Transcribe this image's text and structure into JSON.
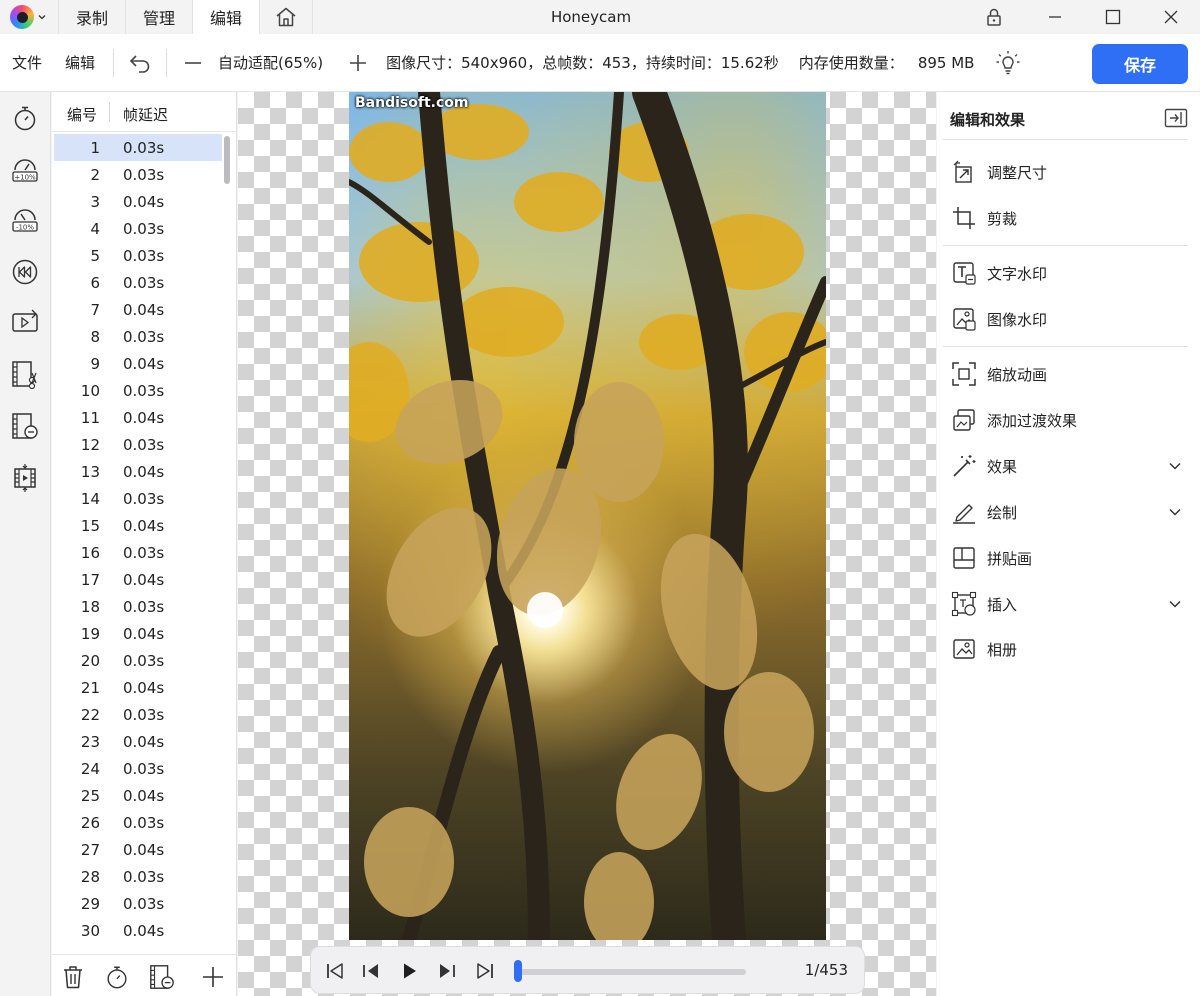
{
  "titlebar": {
    "tabs": [
      {
        "label": "录制"
      },
      {
        "label": "管理"
      },
      {
        "label": "编辑"
      }
    ],
    "active_tab": "编辑",
    "window_title": "Honeycam"
  },
  "toolbar": {
    "file_label": "文件",
    "edit_label": "编辑",
    "zoom_label": "自动适配(65%)",
    "info_text": "图像尺寸：540x960，总帧数：453，持续时间：15.62秒",
    "memory_label": "内存使用数量：",
    "memory_value": "895 MB",
    "save_label": "保存"
  },
  "frame_list": {
    "header_number": "编号",
    "header_delay": "帧延迟",
    "selected": 1,
    "rows": [
      {
        "n": "1",
        "d": "0.03s"
      },
      {
        "n": "2",
        "d": "0.03s"
      },
      {
        "n": "3",
        "d": "0.04s"
      },
      {
        "n": "4",
        "d": "0.03s"
      },
      {
        "n": "5",
        "d": "0.03s"
      },
      {
        "n": "6",
        "d": "0.03s"
      },
      {
        "n": "7",
        "d": "0.04s"
      },
      {
        "n": "8",
        "d": "0.03s"
      },
      {
        "n": "9",
        "d": "0.04s"
      },
      {
        "n": "10",
        "d": "0.03s"
      },
      {
        "n": "11",
        "d": "0.04s"
      },
      {
        "n": "12",
        "d": "0.03s"
      },
      {
        "n": "13",
        "d": "0.04s"
      },
      {
        "n": "14",
        "d": "0.03s"
      },
      {
        "n": "15",
        "d": "0.04s"
      },
      {
        "n": "16",
        "d": "0.03s"
      },
      {
        "n": "17",
        "d": "0.04s"
      },
      {
        "n": "18",
        "d": "0.03s"
      },
      {
        "n": "19",
        "d": "0.04s"
      },
      {
        "n": "20",
        "d": "0.03s"
      },
      {
        "n": "21",
        "d": "0.04s"
      },
      {
        "n": "22",
        "d": "0.03s"
      },
      {
        "n": "23",
        "d": "0.04s"
      },
      {
        "n": "24",
        "d": "0.03s"
      },
      {
        "n": "25",
        "d": "0.04s"
      },
      {
        "n": "26",
        "d": "0.03s"
      },
      {
        "n": "27",
        "d": "0.04s"
      },
      {
        "n": "28",
        "d": "0.03s"
      },
      {
        "n": "29",
        "d": "0.03s"
      },
      {
        "n": "30",
        "d": "0.04s"
      }
    ]
  },
  "canvas": {
    "watermark": "Bandisoft.com"
  },
  "playback": {
    "frame_counter": "1/453",
    "progress_fraction": 0.002
  },
  "effects_panel": {
    "title": "编辑和效果",
    "items": [
      {
        "label": "调整尺寸",
        "icon": "resize-icon"
      },
      {
        "label": "剪裁",
        "icon": "crop-icon"
      },
      {
        "label": "文字水印",
        "icon": "text-watermark-icon"
      },
      {
        "label": "图像水印",
        "icon": "image-watermark-icon"
      },
      {
        "label": "缩放动画",
        "icon": "zoom-animation-icon"
      },
      {
        "label": "添加过渡效果",
        "icon": "transition-icon"
      },
      {
        "label": "效果",
        "icon": "magic-wand-icon"
      },
      {
        "label": "绘制",
        "icon": "draw-icon"
      },
      {
        "label": "拼贴画",
        "icon": "collage-icon"
      },
      {
        "label": "插入",
        "icon": "insert-icon"
      },
      {
        "label": "相册",
        "icon": "album-icon"
      }
    ]
  },
  "colors": {
    "accent": "#2f6ff5",
    "selected_row": "#d6e3f8"
  }
}
